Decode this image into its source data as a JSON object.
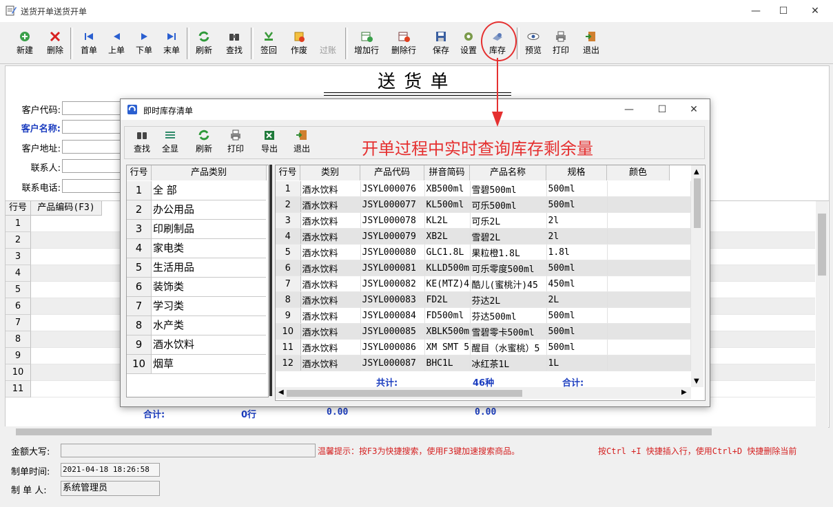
{
  "window": {
    "title": "送货开单送货开单"
  },
  "toolbar": {
    "new": "新建",
    "delete": "删除",
    "first": "首单",
    "prev": "上单",
    "next": "下单",
    "last": "末单",
    "refresh": "刷新",
    "find": "查找",
    "signback": "签回",
    "void": "作废",
    "post": "过账",
    "addrow": "增加行",
    "delrow": "删除行",
    "save": "保存",
    "settings": "设置",
    "stock": "库存",
    "preview": "预览",
    "print": "打印",
    "exit": "退出"
  },
  "form": {
    "doc_title": "送 货 单",
    "customer_code": "客户代码:",
    "customer_name": "客户名称:",
    "customer_address": "客户地址:",
    "contact": "联系人:",
    "phone": "联系电话:"
  },
  "grid": {
    "col_rowno": "行号",
    "col_code": "产品编码(F3)",
    "rows": [
      "1",
      "2",
      "3",
      "4",
      "5",
      "6",
      "7",
      "8",
      "9",
      "10",
      "11"
    ],
    "sum_label": "合计:",
    "sum_rows": "0行",
    "sum_a": "0.00",
    "sum_b": "0.00"
  },
  "footer": {
    "amount_label": "金额大写:",
    "tip1": "温馨提示：按F3为快捷搜索，使用F3键加速搜索商品。",
    "tip2": "按Ctrl +I 快捷插入行，使用Ctrl+D 快捷删除当前",
    "time_label": "制单时间:",
    "time_value": "2021-04-18 18:26:58",
    "maker_label": "制 单 人:",
    "maker_value": "系统管理员"
  },
  "popup": {
    "title": "即时库存清单",
    "toolbar": {
      "find": "查找",
      "showall": "全显",
      "refresh": "刷新",
      "print": "打印",
      "export": "导出",
      "exit": "退出"
    },
    "annotation": "开单过程中实时查询库存剩余量",
    "cat_headers": {
      "rowno": "行号",
      "category": "产品类别"
    },
    "categories": [
      "全 部",
      "办公用品",
      "印刷制品",
      "家电类",
      "生活用品",
      "装饰类",
      "学习类",
      "水产类",
      "酒水饮料",
      "烟草"
    ],
    "prod_headers": {
      "rowno": "行号",
      "type": "类别",
      "code": "产品代码",
      "pinyin": "拼音简码",
      "name": "产品名称",
      "spec": "规格",
      "color": "颜色"
    },
    "products": [
      [
        "1",
        "酒水饮料",
        "JSYL000076",
        "XB500ml",
        "雪碧500ml",
        "500ml"
      ],
      [
        "2",
        "酒水饮料",
        "JSYL000077",
        "KL500ml",
        "可乐500ml",
        "500ml"
      ],
      [
        "3",
        "酒水饮料",
        "JSYL000078",
        "KL2L",
        "可乐2L",
        "2l"
      ],
      [
        "4",
        "酒水饮料",
        "JSYL000079",
        "XB2L",
        "雪碧2L",
        "2l"
      ],
      [
        "5",
        "酒水饮料",
        "JSYL000080",
        "GLC1.8L",
        "果粒橙1.8L",
        "1.8l"
      ],
      [
        "6",
        "酒水饮料",
        "JSYL000081",
        "KLLD500m",
        "可乐零度500ml",
        "500ml"
      ],
      [
        "7",
        "酒水饮料",
        "JSYL000082",
        "KE(MTZ)4",
        "酷儿(蜜桃汁)45",
        "450ml"
      ],
      [
        "8",
        "酒水饮料",
        "JSYL000083",
        "FD2L",
        "芬达2L",
        "2L"
      ],
      [
        "9",
        "酒水饮料",
        "JSYL000084",
        "FD500ml",
        "芬达500ml",
        "500ml"
      ],
      [
        "10",
        "酒水饮料",
        "JSYL000085",
        "XBLK500m",
        "雪碧零卡500ml",
        "500ml"
      ],
      [
        "11",
        "酒水饮料",
        "JSYL000086",
        "XM SMT 5",
        "醒目（水蜜桃）5",
        "500ml"
      ],
      [
        "12",
        "酒水饮料",
        "JSYL000087",
        "BHC1L",
        "冰红茶1L",
        "1L"
      ]
    ],
    "total_label": "共计:",
    "total_count": "46种",
    "sum_label": "合计:"
  },
  "colors": {
    "annotation_red": "#e53030",
    "sum_blue": "#1a3cbf",
    "tip_red": "#d42020"
  }
}
